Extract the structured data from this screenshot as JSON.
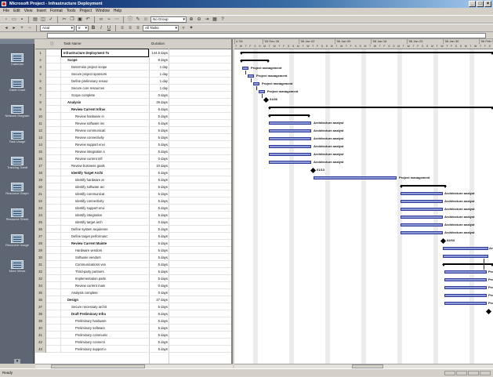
{
  "window": {
    "title": "Microsoft Project - Infrastructure Deployment"
  },
  "menu": [
    "File",
    "Edit",
    "View",
    "Insert",
    "Format",
    "Tools",
    "Project",
    "Window",
    "Help"
  ],
  "toolbar": {
    "group_combo": "No Group",
    "task_combo": "All Tasks",
    "font_combo": "Arial",
    "size_combo": "8"
  },
  "view_bar": [
    {
      "label": "Calendar",
      "icon": "calendar-icon"
    },
    {
      "label": "Gantt Chart",
      "icon": "gantt-chart-icon"
    },
    {
      "label": "Network Diagram",
      "icon": "network-diagram-icon"
    },
    {
      "label": "Task Usage",
      "icon": "task-usage-icon"
    },
    {
      "label": "Tracking Gantt",
      "icon": "tracking-gantt-icon"
    },
    {
      "label": "Resource Graph",
      "icon": "resource-graph-icon"
    },
    {
      "label": "Resource Sheet",
      "icon": "resource-sheet-icon"
    },
    {
      "label": "Resource Usage",
      "icon": "resource-usage-icon"
    },
    {
      "label": "More Views",
      "icon": "more-views-icon"
    }
  ],
  "columns": {
    "task_name": "Task Name",
    "duration": "Duration"
  },
  "tasks": [
    {
      "id": "1",
      "name": "Infrastructure Deployment To",
      "duration": "144.5 days",
      "bold": true
    },
    {
      "id": "2",
      "name": "Scope",
      "duration": "8 days",
      "bold": true
    },
    {
      "id": "3",
      "name": "Determine project scope",
      "duration": "1 day"
    },
    {
      "id": "4",
      "name": "Secure project sponsors",
      "duration": "1 day"
    },
    {
      "id": "5",
      "name": "Define preliminary resour",
      "duration": "1 day"
    },
    {
      "id": "6",
      "name": "Secure core resources",
      "duration": "1 day"
    },
    {
      "id": "7",
      "name": "Scope complete",
      "duration": "0 days"
    },
    {
      "id": "8",
      "name": "Analysis",
      "duration": "29 days",
      "bold": true
    },
    {
      "id": "9",
      "name": "Review Current Infras",
      "duration": "6 days",
      "bold": true
    },
    {
      "id": "10",
      "name": "Review hardware in",
      "duration": "5 days"
    },
    {
      "id": "11",
      "name": "Review software inv",
      "duration": "5 days"
    },
    {
      "id": "12",
      "name": "Review communicati",
      "duration": "5 days"
    },
    {
      "id": "13",
      "name": "Review connectivity",
      "duration": "5 days"
    },
    {
      "id": "14",
      "name": "Review support envi",
      "duration": "5 days"
    },
    {
      "id": "15",
      "name": "Review integration s",
      "duration": "5 days"
    },
    {
      "id": "16",
      "name": "Review current infr",
      "duration": "0 days"
    },
    {
      "id": "17",
      "name": "Review business goals",
      "duration": "10 days"
    },
    {
      "id": "18",
      "name": "Identify Target Archi",
      "duration": "6 days",
      "bold": true
    },
    {
      "id": "19",
      "name": "Identify hardware ar",
      "duration": "5 days"
    },
    {
      "id": "20",
      "name": "Identify software arc",
      "duration": "5 days"
    },
    {
      "id": "21",
      "name": "Identify communicat",
      "duration": "5 days"
    },
    {
      "id": "22",
      "name": "Identify connectivity",
      "duration": "5 days"
    },
    {
      "id": "23",
      "name": "Identify support envi",
      "duration": "5 days"
    },
    {
      "id": "24",
      "name": "Identify integration",
      "duration": "5 days"
    },
    {
      "id": "25",
      "name": "Identify target arch",
      "duration": "0 days"
    },
    {
      "id": "26",
      "name": "Define system requireme",
      "duration": "5 days"
    },
    {
      "id": "27",
      "name": "Define target performanc",
      "duration": "5 days"
    },
    {
      "id": "28",
      "name": "Review Current Mainte",
      "duration": "5 days",
      "bold": true
    },
    {
      "id": "29",
      "name": "Hardware vendors",
      "duration": "5 days"
    },
    {
      "id": "30",
      "name": "Software vendors",
      "duration": "5 days"
    },
    {
      "id": "31",
      "name": "Communications ven",
      "duration": "5 days"
    },
    {
      "id": "32",
      "name": "Third-party partners",
      "duration": "5 days"
    },
    {
      "id": "33",
      "name": "Implementation partn",
      "duration": "5 days"
    },
    {
      "id": "34",
      "name": "Review current main",
      "duration": "0 days"
    },
    {
      "id": "35",
      "name": "Analysis complete",
      "duration": "0 days"
    },
    {
      "id": "36",
      "name": "Design",
      "duration": "27 days",
      "bold": true
    },
    {
      "id": "37",
      "name": "Secure necessary archit",
      "duration": "5 days"
    },
    {
      "id": "38",
      "name": "Draft Preliminary Infra",
      "duration": "8 days",
      "bold": true
    },
    {
      "id": "39",
      "name": "Preliminary hardware",
      "duration": "5 days"
    },
    {
      "id": "40",
      "name": "Preliminary software",
      "duration": "5 days"
    },
    {
      "id": "41",
      "name": "Preliminary communic",
      "duration": "5 days"
    },
    {
      "id": "42",
      "name": "Preliminary connecti",
      "duration": "5 days"
    },
    {
      "id": "43",
      "name": "Preliminary support e",
      "duration": "5 days"
    }
  ],
  "timescale": {
    "weeks": [
      "4 '05",
      "'05 Dec 26",
      "'06 Jan 02",
      "'06 Jan 09",
      "'06 Jan 16",
      "'06 Jan 23",
      "'06 Jan 30",
      "'06 Feb 06"
    ],
    "days": "T W T F S S M T W T F S S M T W T F S S M T W T F S S M T W T F S S M T W T F S S M T W T F S S M T W T F S S M T W"
  },
  "gantt_labels": {
    "pm": "Project management",
    "aa": "Architecture analyst",
    "m1": "01/06",
    "m2": "01/13",
    "m3": "02/03",
    "cut": "Pro",
    "cut2": "Arc"
  },
  "status": {
    "text": "Ready"
  }
}
